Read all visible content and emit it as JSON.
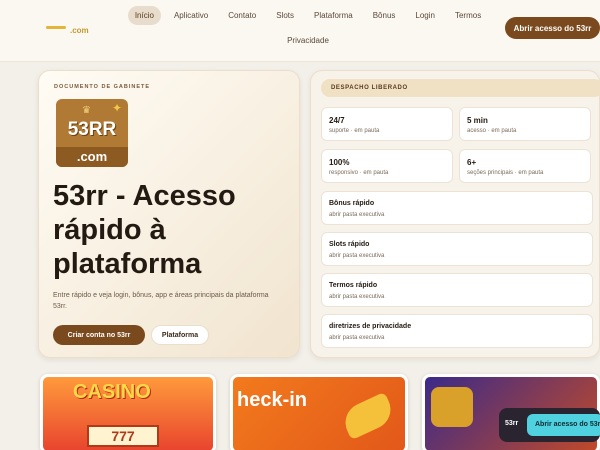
{
  "header": {
    "logo_text": ".com",
    "nav": [
      "Início",
      "Aplicativo",
      "Contato",
      "Slots",
      "Plataforma",
      "Bônus",
      "Login",
      "Termos"
    ],
    "nav_row2": [
      "Privacidade"
    ],
    "cta": "Abrir acesso do 53rr"
  },
  "hero": {
    "eyebrow": "DOCUMENTO DE GABINETE",
    "brand_main": "53RR",
    "brand_sub": ".com",
    "title": "53rr - Acesso rápido à plataforma",
    "desc": "Entre rápido e veja login, bônus, app e áreas principais da plataforma 53rr.",
    "primary_btn": "Criar conta no 53rr",
    "secondary_btn": "Plataforma"
  },
  "panel": {
    "tag": "DESPACHO LIBERADO",
    "stats": [
      {
        "value": "24/7",
        "label": "suporte · em pauta"
      },
      {
        "value": "5 min",
        "label": "acesso · em pauta"
      },
      {
        "value": "100%",
        "label": "responsivo · em pauta"
      },
      {
        "value": "6+",
        "label": "seções principais · em pauta"
      }
    ],
    "links": [
      {
        "title": "Bônus rápido",
        "sub": "abrir pasta executiva"
      },
      {
        "title": "Slots rápido",
        "sub": "abrir pasta executiva"
      },
      {
        "title": "Termos rápido",
        "sub": "abrir pasta executiva"
      },
      {
        "title": "diretrizes de privacidade",
        "sub": "abrir pasta executiva"
      }
    ]
  },
  "cards": {
    "card1_word": "CASINO",
    "card1_num": "777",
    "card2_word": "heck-in"
  },
  "floating": {
    "label": "53rr",
    "button": "Abrir acesso do 53rr"
  }
}
